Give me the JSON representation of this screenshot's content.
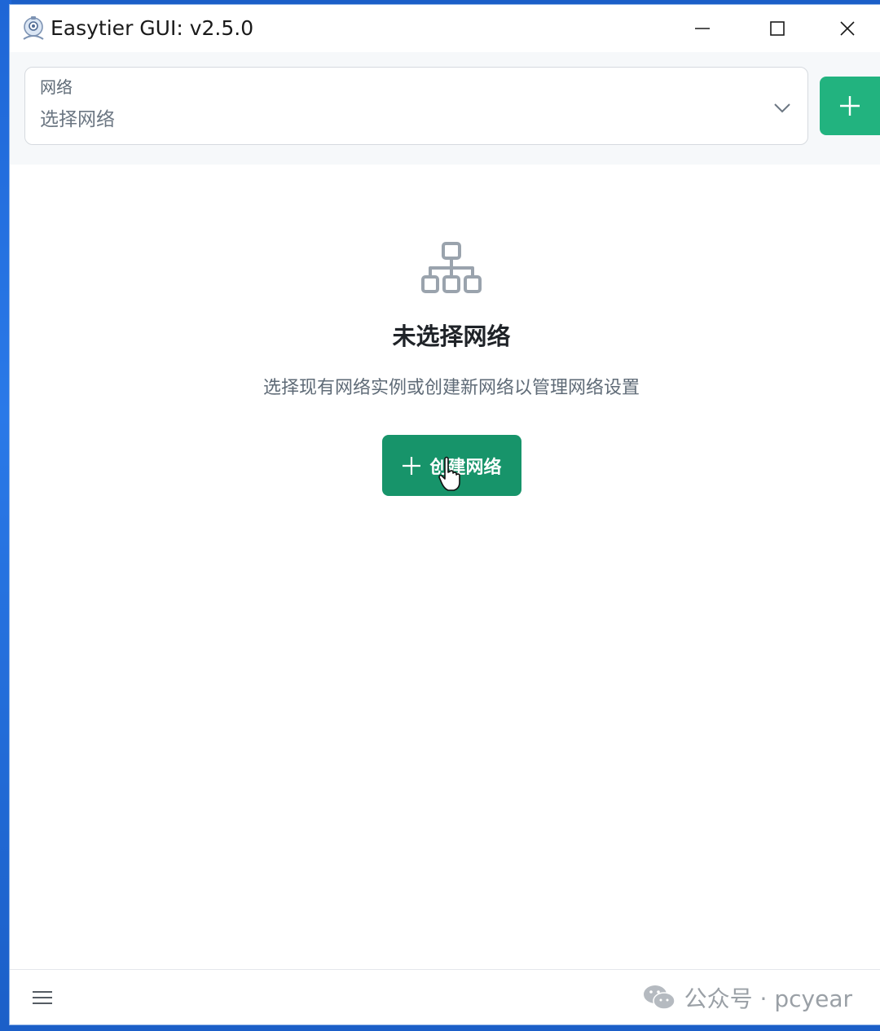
{
  "window": {
    "title": "Easytier GUI: v2.5.0",
    "controls": {
      "minimize": "minimize-icon",
      "maximize": "maximize-icon",
      "close": "close-icon"
    }
  },
  "selector": {
    "label": "网络",
    "placeholder": "选择网络",
    "add_icon": "plus-icon",
    "chevron_icon": "chevron-down-icon"
  },
  "empty_state": {
    "icon": "network-tree-icon",
    "title": "未选择网络",
    "description": "选择现有网络实例或创建新网络以管理网络设置",
    "create_button": "创建网络"
  },
  "bottom": {
    "menu_icon": "menu-icon",
    "watermark": "公众号 · pcyear"
  },
  "colors": {
    "primary": "#17946a",
    "accent": "#22b37f",
    "text": "#1f2328",
    "muted": "#5f6b77"
  }
}
